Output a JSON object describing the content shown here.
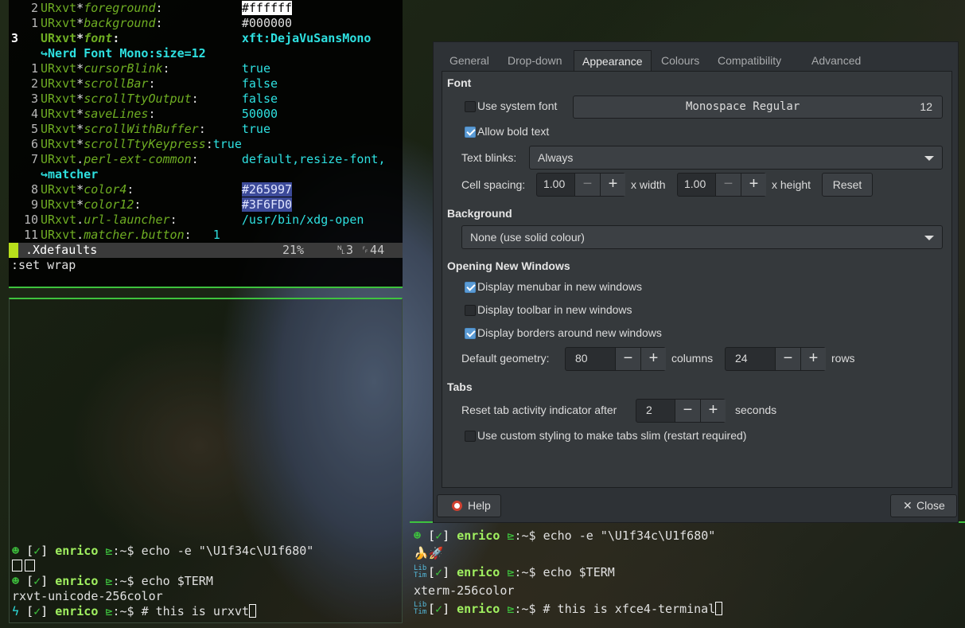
{
  "vim": {
    "lines": [
      {
        "num": "2",
        "key": "URxvt",
        "sep": "*",
        "prop": "foreground",
        "pad": ":           ",
        "val": "#ffffff"
      },
      {
        "num": "1",
        "key": "URxvt",
        "sep": "*",
        "prop": "background",
        "pad": ":           ",
        "val": "#000000"
      },
      {
        "num": "3",
        "key": "URxvt",
        "sep": "*",
        "prop": "font",
        "pad": ":                 ",
        "val": "xft:DejaVuSansMono"
      },
      {
        "wrap": "↪Nerd Font Mono:size=12"
      },
      {
        "num": "1",
        "key": "URxvt",
        "sep": "*",
        "prop": "cursorBlink",
        "pad": ":          ",
        "val": "true"
      },
      {
        "num": "2",
        "key": "URxvt",
        "sep": "*",
        "prop": "scrollBar",
        "pad": ":            ",
        "val": "false"
      },
      {
        "num": "3",
        "key": "URxvt",
        "sep": "*",
        "prop": "scrollTtyOutput",
        "pad": ":      ",
        "val": "false"
      },
      {
        "num": "4",
        "key": "URxvt",
        "sep": "*",
        "prop": "saveLines",
        "pad": ":            ",
        "val": "50000"
      },
      {
        "num": "5",
        "key": "URxvt",
        "sep": "*",
        "prop": "scrollWithBuffer",
        "pad": ":     ",
        "val": "true"
      },
      {
        "num": "6",
        "key": "URxvt",
        "sep": "*",
        "prop": "scrollTtyKeypress",
        "pad": ":",
        "val": "true"
      },
      {
        "num": "7",
        "key": "URxvt",
        "sep": ".",
        "prop": "perl-ext-common",
        "pad": ":      ",
        "val": "default,resize-font,"
      },
      {
        "wrap": "↪matcher"
      },
      {
        "num": "8",
        "key": "URxvt",
        "sep": "*",
        "prop": "color4",
        "pad": ":               ",
        "val": "#265997"
      },
      {
        "num": "9",
        "key": "URxvt",
        "sep": "*",
        "prop": "color12",
        "pad": ":              ",
        "val": "#3F6FD0"
      },
      {
        "num": "10",
        "key": "URxvt",
        "sep": ".",
        "prop": "url-launcher",
        "pad": ":         ",
        "val": "/usr/bin/xdg-open"
      },
      {
        "num": "11",
        "key": "URxvt",
        "sep": ".",
        "prop": "matcher.button",
        "pad": ":   ",
        "val": "1"
      }
    ],
    "status_file": " .Xdefaults",
    "status_pct": "21%",
    "status_pos": "␤3 ␌44",
    "cmdline": ":set wrap"
  },
  "urxvt": {
    "user": "enrico",
    "l1_cmd": "echo -e \"\\U1f34c\\U1f680\"",
    "l3_cmd": "echo $TERM",
    "l4_out": "rxvt-unicode-256color",
    "l5_cmd": "# this is urxvt",
    "check": "✓",
    "dir": "~"
  },
  "xfce": {
    "user": "enrico",
    "l1_cmd": "echo -e \"\\U1f34c\\U1f680\"",
    "l2_out": "🍌🚀",
    "l3_cmd": "echo $TERM",
    "l4_out": "xterm-256color",
    "l5_cmd": "# this is xfce4-terminal",
    "check": "✓",
    "dir": "~"
  },
  "dialog": {
    "tabs": [
      "General",
      "Drop-down",
      "Appearance",
      "Colours",
      "Compatibility",
      "Advanced"
    ],
    "font_section": "Font",
    "use_system_font": "Use system font",
    "font_name": "Monospace Regular",
    "font_size": "12",
    "allow_bold": "Allow bold text",
    "text_blinks_label": "Text blinks:",
    "text_blinks_value": "Always",
    "cell_spacing_label": "Cell spacing:",
    "width_value": "1.00",
    "width_unit": "x width",
    "height_value": "1.00",
    "height_unit": "x height",
    "reset": "Reset",
    "bg_section": "Background",
    "bg_value": "None (use solid colour)",
    "onw_section": "Opening New Windows",
    "menubar": "Display menubar in new windows",
    "toolbar": "Display toolbar in new windows",
    "borders": "Display borders around new windows",
    "geometry_label": "Default geometry:",
    "columns_value": "80",
    "columns_label": "columns",
    "rows_value": "24",
    "rows_label": "rows",
    "tabs_section": "Tabs",
    "reset_tab_label": "Reset tab activity indicator after",
    "reset_tab_value": "2",
    "seconds": "seconds",
    "slim_tabs": "Use custom styling to make tabs slim (restart required)",
    "help": "Help",
    "close": "Close"
  }
}
